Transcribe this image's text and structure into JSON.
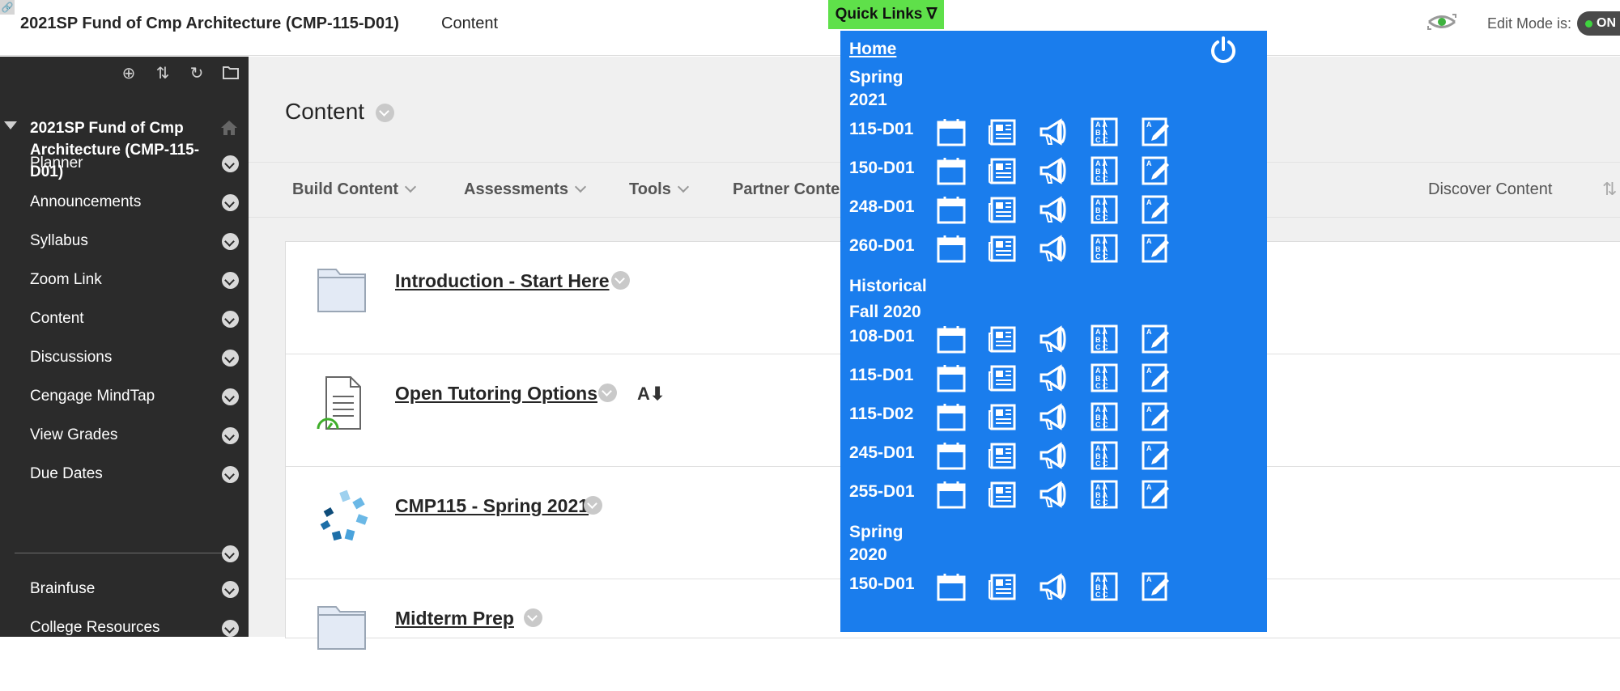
{
  "header": {
    "course_title": "2021SP Fund of Cmp Architecture (CMP-115-D01)",
    "content_link": "Content",
    "edit_mode_label": "Edit Mode is:",
    "edit_mode_state": "ON"
  },
  "sidebar": {
    "course_name": "2021SP Fund of Cmp Architecture (CMP-115-D01)",
    "items": [
      {
        "label": "Planner"
      },
      {
        "label": "Announcements"
      },
      {
        "label": "Syllabus"
      },
      {
        "label": "Zoom Link"
      },
      {
        "label": "Content"
      },
      {
        "label": "Discussions"
      },
      {
        "label": "Cengage MindTap"
      },
      {
        "label": "View Grades"
      },
      {
        "label": "Due Dates"
      }
    ],
    "items_after_divider": [
      {
        "label": "Brainfuse"
      },
      {
        "label": "College Resources"
      }
    ]
  },
  "main": {
    "page_title": "Content",
    "actions": [
      "Build Content",
      "Assessments",
      "Tools",
      "Partner Content"
    ],
    "discover": "Discover Content",
    "rows": [
      {
        "title": "Introduction - Start Here",
        "icon": "folder-icon"
      },
      {
        "title": "Open Tutoring Options",
        "icon": "document-icon"
      },
      {
        "title": "CMP115 - Spring 2021",
        "icon": "cengage-logo-icon"
      },
      {
        "title": "Midterm Prep",
        "icon": "folder-icon"
      }
    ]
  },
  "quick_links": {
    "tab_label": "Quick Links ∇",
    "home": "Home",
    "sections": [
      {
        "heading": "Spring 2021",
        "courses": [
          "115-D01",
          "150-D01",
          "248-D01",
          "260-D01"
        ]
      },
      {
        "heading": "Historical",
        "courses": []
      },
      {
        "heading": "Fall 2020",
        "courses": [
          "108-D01",
          "115-D01",
          "115-D02",
          "245-D01",
          "255-D01"
        ]
      },
      {
        "heading": "Spring 2020",
        "courses": [
          "150-D01"
        ]
      }
    ],
    "icon_names": [
      "calendar-icon",
      "news-icon",
      "megaphone-icon",
      "gradebook-icon",
      "edit-assignment-icon"
    ]
  },
  "colors": {
    "sidebar_bg": "#2b2b2b",
    "quick_links_bg": "#1a7ded",
    "quick_links_tab": "#5fe04a"
  }
}
